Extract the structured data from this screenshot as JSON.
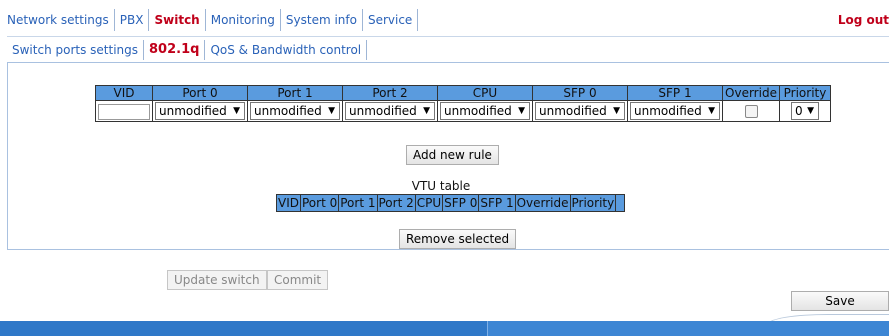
{
  "topmenu": {
    "items": [
      "Network settings",
      "PBX",
      "Switch",
      "Monitoring",
      "System info",
      "Service"
    ],
    "active": "Switch",
    "logout": "Log out"
  },
  "submenu": {
    "items": [
      "Switch ports settings",
      "802.1q",
      "QoS & Bandwidth control"
    ],
    "active": "802.1q"
  },
  "rules_table": {
    "headers": [
      "VID",
      "Port 0",
      "Port 1",
      "Port 2",
      "CPU",
      "SFP 0",
      "SFP 1",
      "Override",
      "Priority"
    ],
    "vid_value": "",
    "port_values": [
      "unmodified",
      "unmodified",
      "unmodified",
      "unmodified",
      "unmodified",
      "unmodified"
    ],
    "override_checked": false,
    "priority_value": "0"
  },
  "buttons": {
    "add_rule": "Add new rule",
    "remove_selected": "Remove selected",
    "update_switch": "Update switch",
    "commit": "Commit",
    "save": "Save"
  },
  "vtu": {
    "title": "VTU table",
    "headers": [
      "VID",
      "Port 0",
      "Port 1",
      "Port 2",
      "CPU",
      "SFP 0",
      "SFP 1",
      "Override",
      "Priority",
      ""
    ]
  },
  "colors": {
    "header_bg": "#5a9bde",
    "link": "#2a62b8",
    "active": "#c0001a",
    "bottom_bar": "#2f78c8"
  },
  "icons": {
    "dropdown": "chevron-down-icon"
  }
}
